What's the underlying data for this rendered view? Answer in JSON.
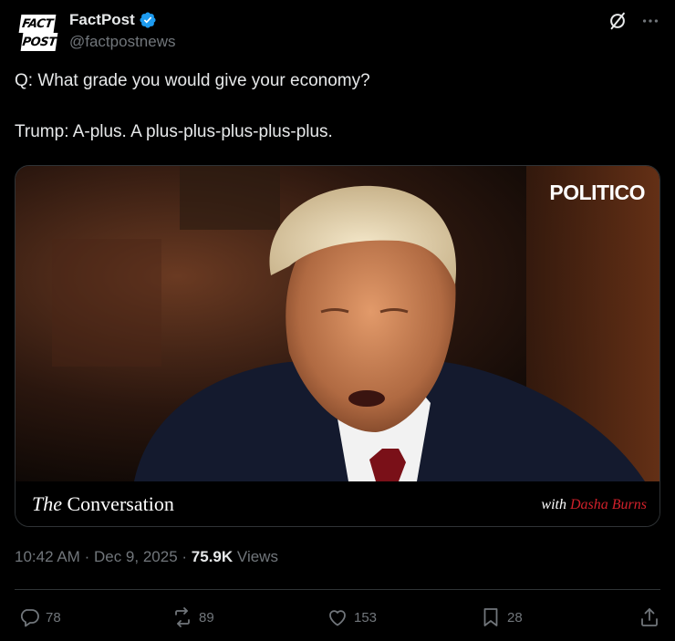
{
  "author": {
    "display_name": "FactPost",
    "handle": "@factpostnews",
    "avatar_text_top": "FACT",
    "avatar_text_bottom": "POST",
    "verified": true
  },
  "tweet": {
    "line1": "Q: What grade you would give your economy?",
    "line2": "Trump: A-plus. A plus-plus-plus-plus-plus."
  },
  "media": {
    "brand": "POLITICO",
    "show_title_the": "The",
    "show_title_rest": "Conversation",
    "host_prefix": "with",
    "host_name": "Dasha Burns"
  },
  "meta": {
    "time": "10:42 AM",
    "separator": "·",
    "date": "Dec 9, 2025",
    "views_count": "75.9K",
    "views_label": "Views"
  },
  "actions": {
    "replies": "78",
    "reposts": "89",
    "likes": "153",
    "bookmarks": "28"
  },
  "icons": [
    "grok-icon",
    "more-icon",
    "reply-icon",
    "repost-icon",
    "like-icon",
    "bookmark-icon",
    "share-icon",
    "verified-badge-icon"
  ],
  "colors": {
    "background": "#000000",
    "text": "#e7e9ea",
    "muted": "#71767b",
    "verified": "#1d9bf0",
    "host_name": "#d0202a"
  }
}
